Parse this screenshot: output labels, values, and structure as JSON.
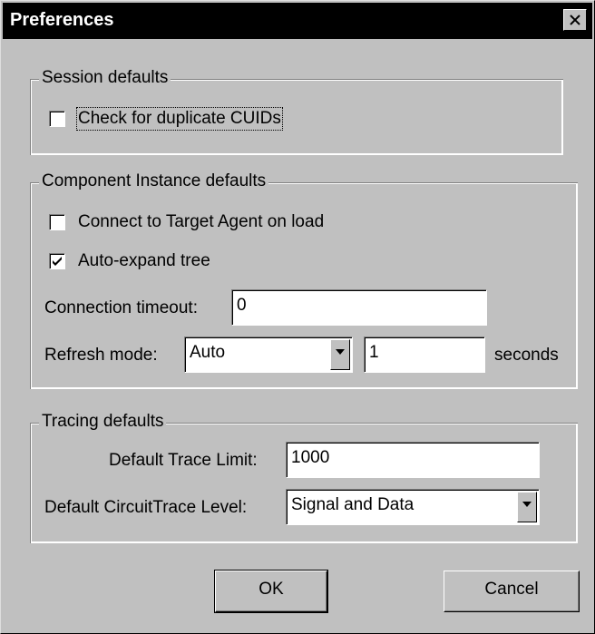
{
  "window": {
    "title": "Preferences"
  },
  "session": {
    "legend": "Session defaults",
    "check_duplicate": {
      "label": "Check for duplicate CUIDs",
      "checked": false
    }
  },
  "component": {
    "legend": "Component Instance defaults",
    "connect_agent": {
      "label": "Connect to Target Agent on load",
      "checked": false
    },
    "auto_expand": {
      "label": "Auto-expand tree",
      "checked": true
    },
    "timeout_label": "Connection timeout:",
    "timeout_value": "0",
    "refresh_label": "Refresh mode:",
    "refresh_mode": "Auto",
    "refresh_interval": "1",
    "seconds_label": "seconds"
  },
  "tracing": {
    "legend": "Tracing defaults",
    "trace_limit_label": "Default Trace Limit:",
    "trace_limit_value": "1000",
    "trace_level_label": "Default CircuitTrace Level:",
    "trace_level_value": "Signal and Data"
  },
  "buttons": {
    "ok": "OK",
    "cancel": "Cancel"
  },
  "icons": {
    "close": "close-icon",
    "checkmark": "checkmark-icon",
    "dropdown": "chevron-down-icon"
  }
}
